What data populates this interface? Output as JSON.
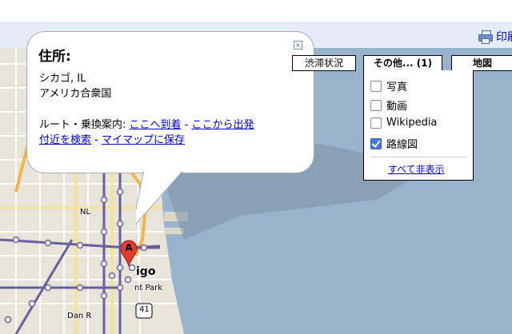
{
  "toolbar": {
    "print_label": "印刷"
  },
  "info_window": {
    "title": "住所:",
    "address_line1": "シカゴ, IL",
    "address_line2": "アメリカ合衆国",
    "route_label": "ルート・乗換案内:",
    "to_here": "ここへ到着",
    "sep1": " - ",
    "from_here": "ここから出発",
    "search_nearby": "付近を検索",
    "sep2": " - ",
    "save_mymap": "マイマップに保存"
  },
  "map_controls": {
    "traffic": "渋滞状況",
    "more": "その他... (1)",
    "map_type": "地図"
  },
  "more_menu": {
    "items": [
      {
        "label": "写真",
        "checked": false
      },
      {
        "label": "動画",
        "checked": false
      },
      {
        "label": "Wikipedia",
        "checked": false
      },
      {
        "label": "路線図",
        "checked": true
      }
    ],
    "hide_all": "すべて非表示"
  },
  "map_labels": {
    "marker": "A",
    "city_fragment": "igo",
    "park_fragment": "nt Park",
    "nl_fragment": "NL",
    "highway": "41",
    "street_fragment": "Dan R"
  },
  "colors": {
    "water": "#99b3cc",
    "land": "#e8e4d9",
    "link": "#0000cc",
    "marker": "#e33b2f",
    "transit_line": "#6a5f9e"
  }
}
